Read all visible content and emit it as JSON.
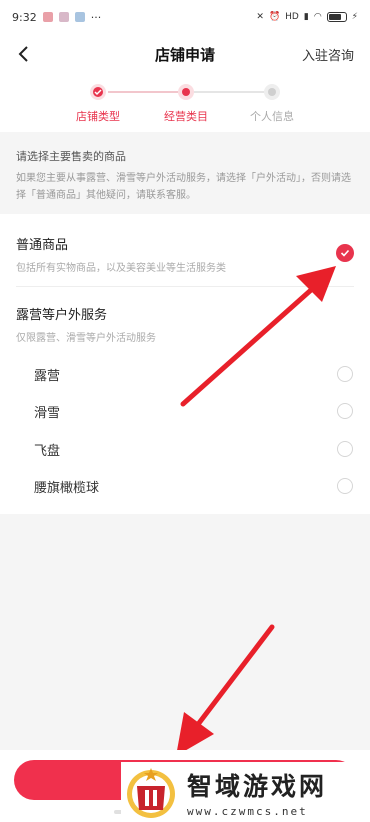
{
  "status_bar": {
    "time": "9:32",
    "dots": "···",
    "signal_tag": "HD"
  },
  "nav": {
    "title": "店铺申请",
    "consult": "入驻咨询"
  },
  "steps": [
    {
      "label": "店铺类型",
      "state": "done"
    },
    {
      "label": "经营类目",
      "state": "active"
    },
    {
      "label": "个人信息",
      "state": "todo"
    }
  ],
  "notice": {
    "title": "请选择主要售卖的商品",
    "desc": "如果您主要从事露营、滑雪等户外活动服务，请选择「户外活动」，否则请选择「普通商品」其他疑问，请联系客服。"
  },
  "options": [
    {
      "title": "普通商品",
      "desc": "包括所有实物商品，以及美容美业等生活服务类",
      "selected": true
    },
    {
      "title": "露营等户外服务",
      "desc": "仅限露营、滑雪等户外活动服务",
      "selected": false,
      "sub_items": [
        "露营",
        "滑雪",
        "飞盘",
        "腰旗橄榄球"
      ]
    }
  ],
  "watermark": {
    "title": "智域游戏网",
    "url": "www.czwmcs.net"
  },
  "colors": {
    "accent": "#e8344d",
    "button": "#f0304d",
    "arrow": "#e8202a"
  }
}
